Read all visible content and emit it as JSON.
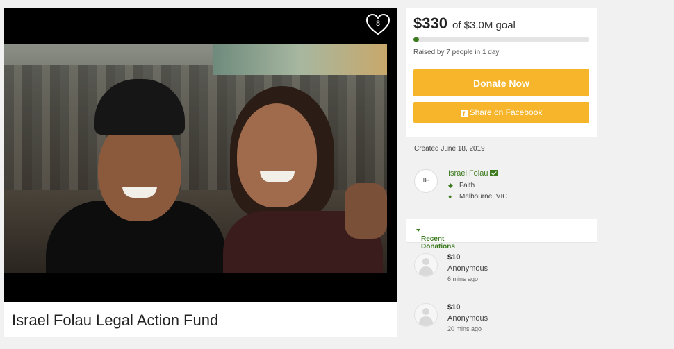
{
  "campaign": {
    "title": "Israel Folau Legal Action Fund",
    "hearts": "8"
  },
  "goal": {
    "amount": "$330",
    "goal_text": "of $3.0M goal",
    "progress_fraction": 0.0001,
    "raised_text": "Raised by 7 people in 1 day",
    "donate_label": "Donate Now",
    "share_label": "Share on Facebook"
  },
  "organizer": {
    "created": "Created June 18, 2019",
    "initials": "IF",
    "name": "Israel Folau",
    "category": "Faith",
    "location": "Melbourne, VIC"
  },
  "donations": {
    "header": "Recent Donations",
    "items": [
      {
        "amount": "$10",
        "name": "Anonymous",
        "time": "6 mins ago"
      },
      {
        "amount": "$10",
        "name": "Anonymous",
        "time": "20 mins ago"
      }
    ]
  },
  "colors": {
    "accent": "#3b7a1e",
    "button": "#f7b52b"
  }
}
